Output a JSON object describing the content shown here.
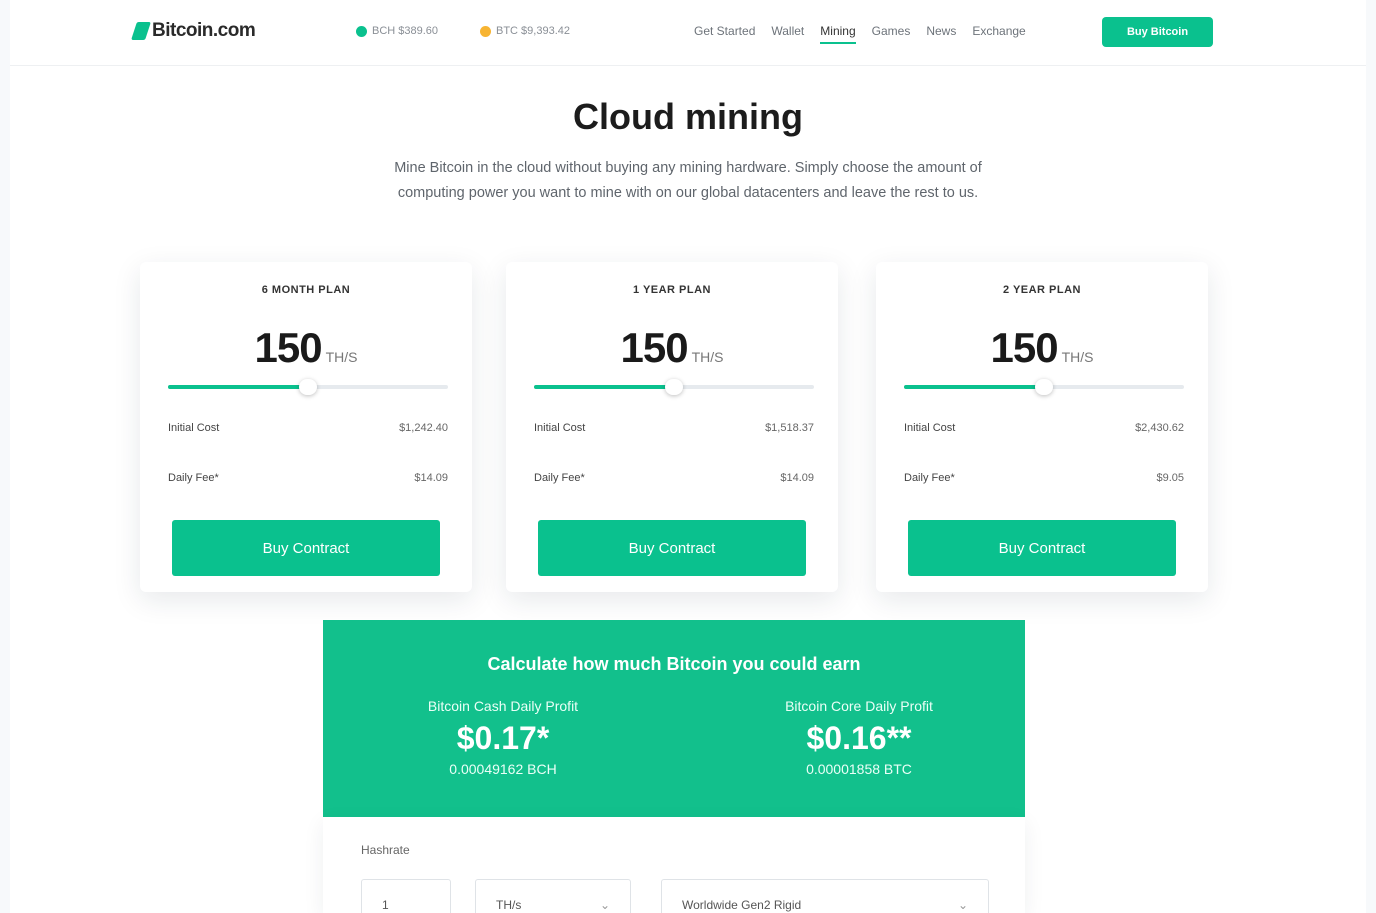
{
  "header": {
    "logo_text": "Bitcoin.com",
    "tickers": [
      {
        "label": "BCH $389.60",
        "color": "#0ac18e"
      },
      {
        "label": "BTC $9,393.42",
        "color": "#f7b432"
      }
    ],
    "nav": [
      "Get Started",
      "Wallet",
      "Mining",
      "Games",
      "News",
      "Exchange"
    ],
    "nav_active": "Mining",
    "cta_label": "Buy Bitcoin"
  },
  "hero": {
    "title": "Cloud mining",
    "subtitle": "Mine Bitcoin in the cloud without buying any mining hardware. Simply choose the amount of computing power you want to mine with on our global datacenters and leave the rest to us."
  },
  "plans": [
    {
      "title": "6 MONTH PLAN",
      "value": "150",
      "unit": "TH/S",
      "slider_fraction": 0.5,
      "initial_cost_label": "Initial Cost",
      "initial_cost": "$1,242.40",
      "daily_fee_label": "Daily Fee*",
      "daily_fee": "$14.09",
      "button": "Buy Contract"
    },
    {
      "title": "1 YEAR PLAN",
      "value": "150",
      "unit": "TH/S",
      "slider_fraction": 0.5,
      "initial_cost_label": "Initial Cost",
      "initial_cost": "$1,518.37",
      "daily_fee_label": "Daily Fee*",
      "daily_fee": "$14.09",
      "button": "Buy Contract"
    },
    {
      "title": "2 YEAR PLAN",
      "value": "150",
      "unit": "TH/S",
      "slider_fraction": 0.5,
      "initial_cost_label": "Initial Cost",
      "initial_cost": "$2,430.62",
      "daily_fee_label": "Daily Fee*",
      "daily_fee": "$9.05",
      "button": "Buy Contract"
    }
  ],
  "calculator": {
    "title": "Calculate how much Bitcoin you could earn",
    "left": {
      "label": "Bitcoin Cash Daily Profit",
      "value": "$0.17*",
      "sub": "0.00049162 BCH"
    },
    "right": {
      "label": "Bitcoin Core Daily Profit",
      "value": "$0.16**",
      "sub": "0.00001858 BTC"
    },
    "form_label": "Hashrate",
    "fields": [
      {
        "value": "1"
      },
      {
        "value": "TH/s",
        "chevron": "chevron-down-icon"
      },
      {
        "value": "Worldwide Gen2 Rigid",
        "chevron": "chevron-down-icon"
      }
    ]
  },
  "colors": {
    "accent": "#0ac18e",
    "calc_bg": "#12c08c"
  }
}
